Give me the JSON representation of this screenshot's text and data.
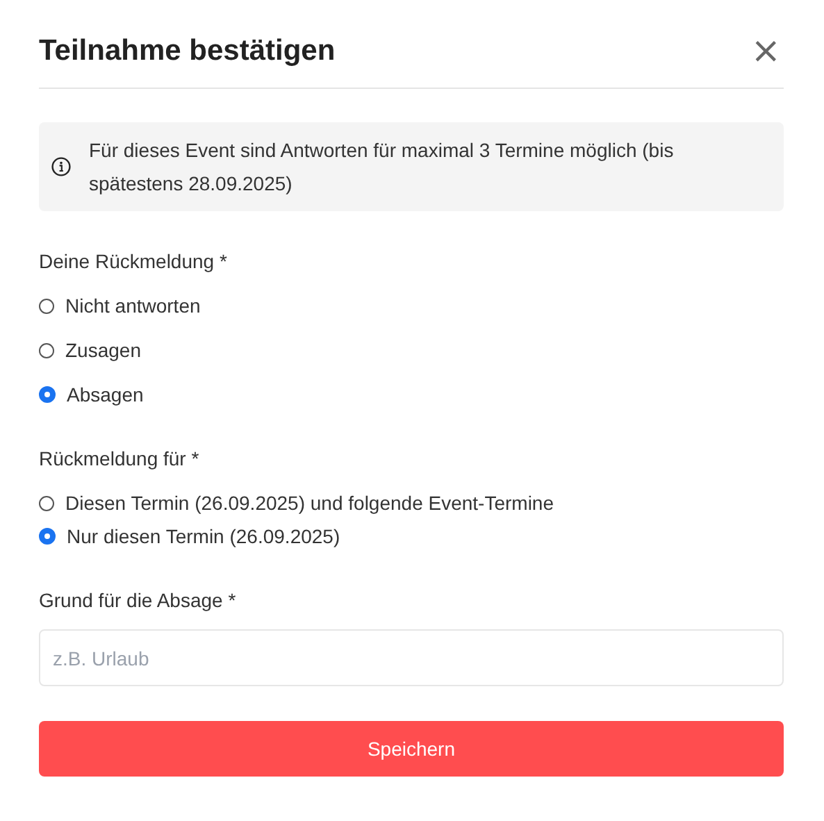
{
  "dialog": {
    "title": "Teilnahme bestätigen",
    "close": "×"
  },
  "notice": {
    "text": "Für dieses Event sind Antworten für maximal 3 Termine möglich (bis spätestens 28.09.2025)"
  },
  "groups": [
    {
      "label": "Deine Rückmeldung *",
      "options": [
        {
          "label": "Nicht antworten",
          "selected": false
        },
        {
          "label": "Zusagen",
          "selected": false
        },
        {
          "label": "Absagen",
          "selected": true
        }
      ]
    },
    {
      "label": "Rückmeldung für *",
      "options": [
        {
          "label": "Diesen Termin (26.09.2025) und folgende Event-Termine",
          "selected": false
        },
        {
          "label": "Nur diesen Termin (26.09.2025)",
          "selected": true
        }
      ]
    }
  ],
  "reason": {
    "label": "Grund für die Absage *",
    "placeholder": "z.B. Urlaub"
  },
  "buttons": [
    {
      "label": "Speichern"
    }
  ]
}
